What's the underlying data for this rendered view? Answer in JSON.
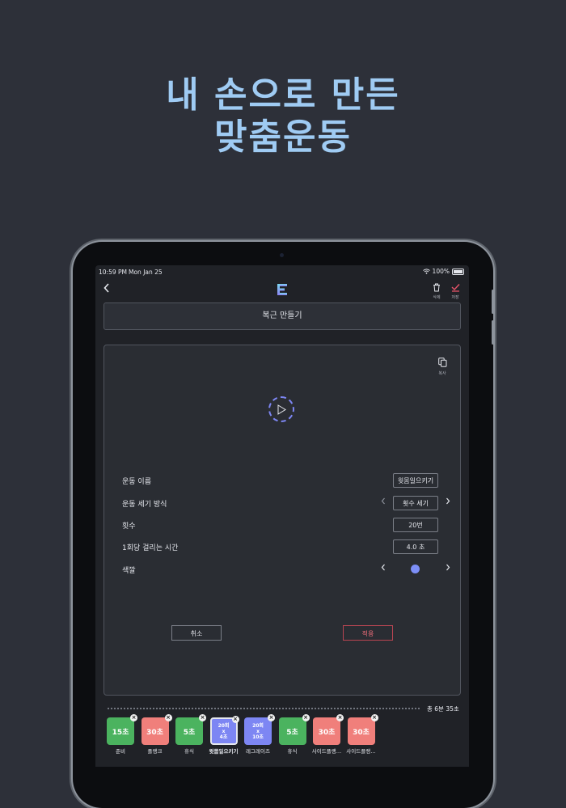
{
  "headline": {
    "line1": "내 손으로 만든",
    "line2": "맞춤운동"
  },
  "status_bar": {
    "time": "10:59 PM",
    "date": "Mon Jan 25",
    "battery": "100%"
  },
  "nav": {
    "delete_label": "삭제",
    "save_label": "저장",
    "back_icon": "chevron-left-icon",
    "logo_icon": "app-logo-icon"
  },
  "routine_title": "복근 만들기",
  "panel": {
    "copy_label": "복사",
    "fields": {
      "name_label": "운동 이름",
      "name_value": "윗몸일으키기",
      "count_mode_label": "운동 세기 방식",
      "count_mode_value": "횟수 세기",
      "reps_label": "횟수",
      "reps_value": "20번",
      "time_per_rep_label": "1회당 걸리는 시간",
      "time_per_rep_value": "4.0 초",
      "color_label": "색깔",
      "color_value": "#7d8ff7"
    },
    "cancel_label": "취소",
    "apply_label": "적용"
  },
  "timeline": {
    "total_time": "총 6분 35초",
    "items": [
      {
        "value": "15초",
        "label": "준비",
        "color": "#4bb35f"
      },
      {
        "value": "30초",
        "label": "플랭크",
        "color": "#f07f7b"
      },
      {
        "value": "5초",
        "label": "휴식",
        "color": "#4bb35f"
      },
      {
        "value_lines": [
          "20회",
          "x",
          "4초"
        ],
        "label": "윗몸일으키기",
        "color": "#7d86f3",
        "selected": true
      },
      {
        "value_lines": [
          "20회",
          "x",
          "10초"
        ],
        "label": "레그레이즈",
        "color": "#7d86f3"
      },
      {
        "value": "5초",
        "label": "휴식",
        "color": "#4bb35f"
      },
      {
        "value": "30초",
        "label": "사이드플랭…",
        "color": "#f07f7b"
      },
      {
        "value": "30초",
        "label": "사이드플랭…",
        "color": "#f07f7b"
      }
    ]
  }
}
